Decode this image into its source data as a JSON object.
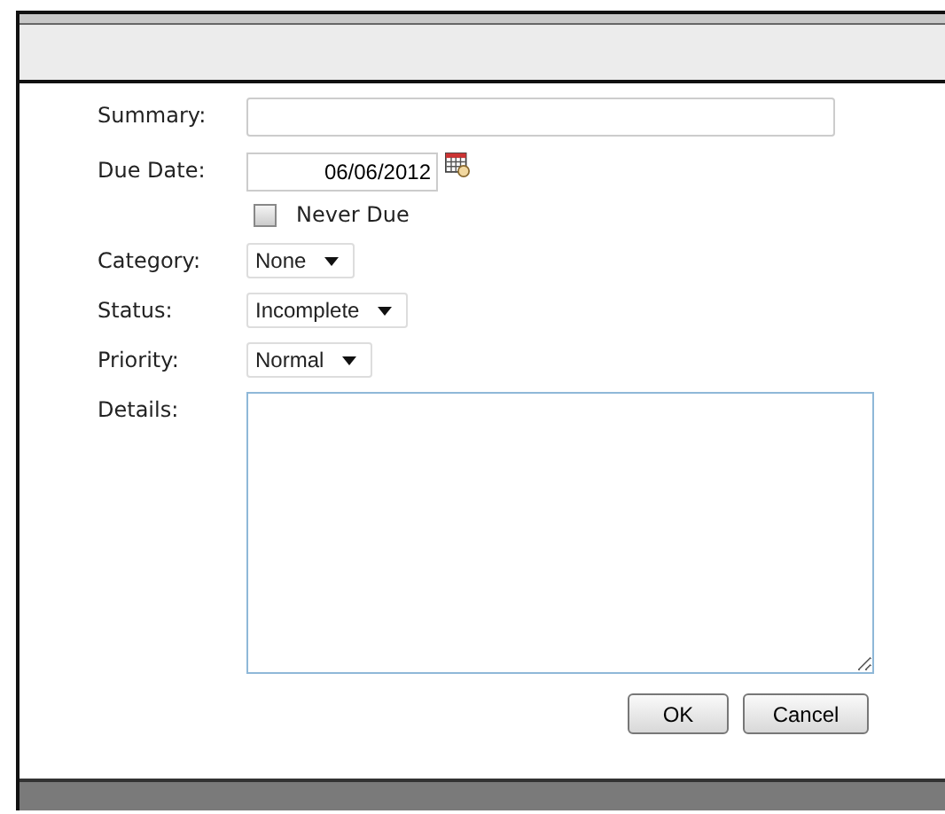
{
  "form": {
    "summary": {
      "label": "Summary:"
    },
    "due_date": {
      "label": "Due Date:",
      "value": "06/06/2012"
    },
    "never_due": {
      "label": "Never Due",
      "checked": false
    },
    "selects": [
      {
        "label": "Category:",
        "value": "None"
      },
      {
        "label": "Status:",
        "value": "Incomplete"
      },
      {
        "label": "Priority:",
        "value": "Normal"
      }
    ],
    "details": {
      "label": "Details:"
    }
  },
  "buttons": [
    "OK",
    "Cancel"
  ]
}
